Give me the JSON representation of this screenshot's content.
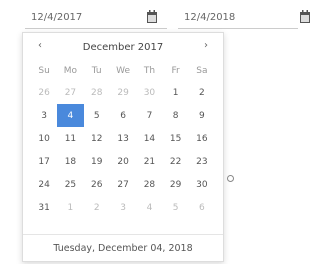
{
  "start_date": "12/4/2017",
  "end_date": "12/4/2018",
  "calendar": {
    "month_label": "December 2017",
    "prev_glyph": "‹",
    "next_glyph": "›",
    "weekdays": [
      "Su",
      "Mo",
      "Tu",
      "We",
      "Th",
      "Fr",
      "Sa"
    ],
    "weeks": [
      [
        {
          "d": "26",
          "other": true
        },
        {
          "d": "27",
          "other": true
        },
        {
          "d": "28",
          "other": true
        },
        {
          "d": "29",
          "other": true
        },
        {
          "d": "30",
          "other": true
        },
        {
          "d": "1"
        },
        {
          "d": "2"
        }
      ],
      [
        {
          "d": "3"
        },
        {
          "d": "4",
          "selected": true
        },
        {
          "d": "5"
        },
        {
          "d": "6"
        },
        {
          "d": "7"
        },
        {
          "d": "8"
        },
        {
          "d": "9"
        }
      ],
      [
        {
          "d": "10"
        },
        {
          "d": "11"
        },
        {
          "d": "12"
        },
        {
          "d": "13"
        },
        {
          "d": "14"
        },
        {
          "d": "15"
        },
        {
          "d": "16"
        }
      ],
      [
        {
          "d": "17"
        },
        {
          "d": "18"
        },
        {
          "d": "19"
        },
        {
          "d": "20"
        },
        {
          "d": "21"
        },
        {
          "d": "22"
        },
        {
          "d": "23"
        }
      ],
      [
        {
          "d": "24"
        },
        {
          "d": "25"
        },
        {
          "d": "26"
        },
        {
          "d": "27"
        },
        {
          "d": "28"
        },
        {
          "d": "29"
        },
        {
          "d": "30"
        }
      ],
      [
        {
          "d": "31"
        },
        {
          "d": "1",
          "other": true
        },
        {
          "d": "2",
          "other": true
        },
        {
          "d": "3",
          "other": true
        },
        {
          "d": "4",
          "other": true
        },
        {
          "d": "5",
          "other": true
        },
        {
          "d": "6",
          "other": true
        }
      ]
    ],
    "footer": "Tuesday, December 04, 2018",
    "accent": "#4a89dc"
  }
}
